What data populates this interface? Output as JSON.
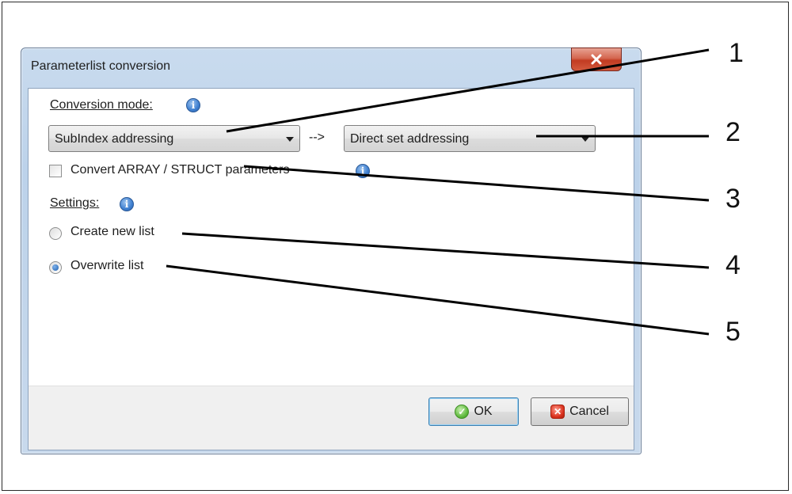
{
  "dialog": {
    "title": "Parameterlist conversion",
    "close_glyph": "x"
  },
  "conversion": {
    "label": "Conversion mode:",
    "source_value": "SubIndex addressing",
    "arrow": "-->",
    "target_value": "Direct set addressing"
  },
  "convert_array": {
    "label": "Convert ARRAY / STRUCT parameters",
    "checked": false
  },
  "settings": {
    "label": "Settings:",
    "options": [
      {
        "label": "Create new list",
        "checked": false
      },
      {
        "label": "Overwrite list",
        "checked": true
      }
    ]
  },
  "buttons": {
    "ok": "OK",
    "cancel": "Cancel"
  },
  "callouts": [
    "1",
    "2",
    "3",
    "4",
    "5"
  ],
  "icons": {
    "info": "info-icon",
    "ok": "ok-check-icon",
    "cancel": "cancel-x-icon",
    "close": "close-icon"
  },
  "colors": {
    "close_button": "#c23b22",
    "info_icon": "#3e7fd0",
    "ok_icon": "#5cb83a",
    "cancel_icon": "#d9301c"
  }
}
